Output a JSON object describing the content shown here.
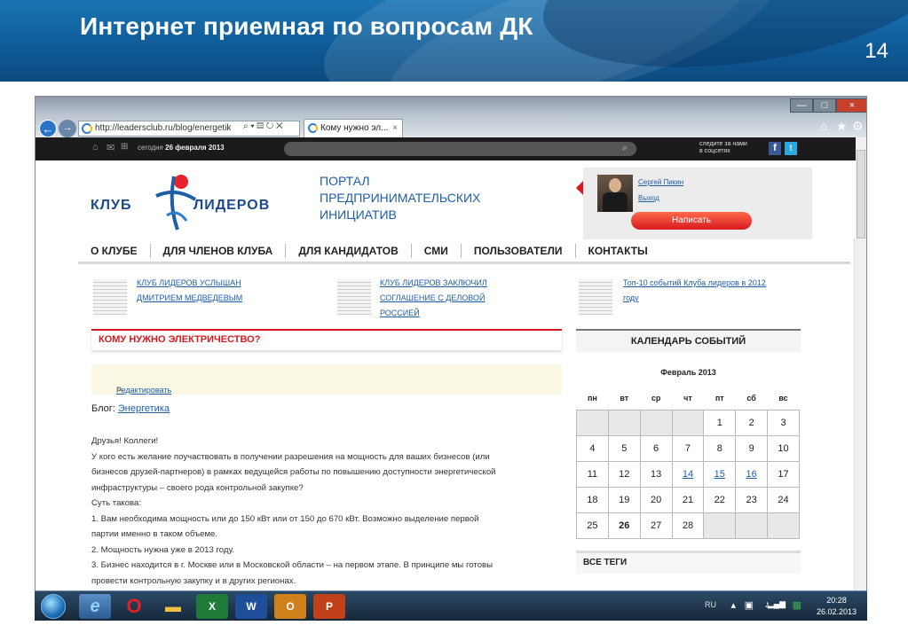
{
  "slide": {
    "title": "Интернет приемная по вопросам ДК",
    "number": "14"
  },
  "browser": {
    "address": "http://leadersclub.ru/blog/energetik",
    "tab_title": "Кому нужно эл...",
    "tab_close": "×",
    "window_buttons": [
      "—",
      "□",
      "×"
    ],
    "tools": [
      "⌂",
      "★",
      "⚙"
    ],
    "address_tools": "⌕ ▾ ▤ ↻ ✕"
  },
  "site": {
    "topbar": {
      "date_prefix": "сегодня",
      "date": "26 февраля 2013",
      "follow_line1": "следите за нами",
      "follow_line2": "в соцсетях"
    },
    "logo": {
      "left": "КЛУБ",
      "right": "ЛИДЕРОВ"
    },
    "portal": {
      "line1": "ПОРТАЛ",
      "line2": "ПРЕДПРИНИМАТЕЛЬСКИХ",
      "line3": "ИНИЦИАТИВ"
    },
    "user": {
      "name": "Сергей Пикин",
      "logout": "Выход",
      "write": "Написать"
    },
    "menu": [
      "О КЛУБЕ",
      "ДЛЯ ЧЛЕНОВ КЛУБА",
      "ДЛЯ КАНДИДАТОВ",
      "СМИ",
      "ПОЛЬЗОВАТЕЛИ",
      "КОНТАКТЫ"
    ],
    "news": [
      {
        "lines": [
          "КЛУБ ЛИДЕРОВ УСЛЫШАН",
          "ДМИТРИЕМ МЕДВЕДЕВЫМ"
        ]
      },
      {
        "lines": [
          "КЛУБ ЛИДЕРОВ ЗАКЛЮЧИЛ",
          "СОГЛАШЕНИЕ С ДЕЛОВОЙ",
          "РОССИЕЙ"
        ]
      },
      {
        "lines": [
          "Топ-10 событий Клуба лидеров в 2012",
          "году"
        ]
      }
    ],
    "article": {
      "title": "КОМУ НУЖНО ЭЛЕКТРИЧЕСТВО?",
      "edit": "Редактировать",
      "blog_label": "Блог:",
      "blog_name": "Энергетика",
      "paragraphs": [
        "Друзья! Коллеги!",
        "У кого есть желание поучаствовать в получении разрешения на мощность для ваших бизнесов (или",
        "бизнесов друзей-партнеров) в рамках ведущейся работы по повышению доступности энергетической",
        "инфраструктуры – своего рода контрольной закупке?",
        "Суть такова:",
        "1. Вам необходима мощность или до 150 кВт или от 150 до 670 кВт. Возможно выделение первой",
        "партии именно в таком объеме.",
        "2. Мощность нужна уже в 2013 году.",
        "3. Бизнес находится в г. Москве или в Московской области – на первом этапе. В принципе мы готовы",
        "провести контрольную закупку и в других регионах."
      ]
    },
    "calendar": {
      "title": "КАЛЕНДАРЬ СОБЫТИЙ",
      "month": "Февраль 2013",
      "weekdays": [
        "пн",
        "вт",
        "ср",
        "чт",
        "пт",
        "сб",
        "вс"
      ],
      "weeks": [
        [
          "",
          "",
          "",
          "",
          "1",
          "2",
          "3"
        ],
        [
          "4",
          "5",
          "6",
          "7",
          "8",
          "9",
          "10"
        ],
        [
          "11",
          "12",
          "13",
          "14",
          "15",
          "16",
          "17"
        ],
        [
          "18",
          "19",
          "20",
          "21",
          "22",
          "23",
          "24"
        ],
        [
          "25",
          "26",
          "27",
          "28",
          "",
          "",
          ""
        ]
      ],
      "event_days": [
        "14",
        "15",
        "16"
      ],
      "today": "26"
    },
    "tags_title": "ВСЕ ТЕГИ"
  },
  "taskbar": {
    "lang": "RU",
    "time": "20:28",
    "date": "26.02.2013"
  }
}
